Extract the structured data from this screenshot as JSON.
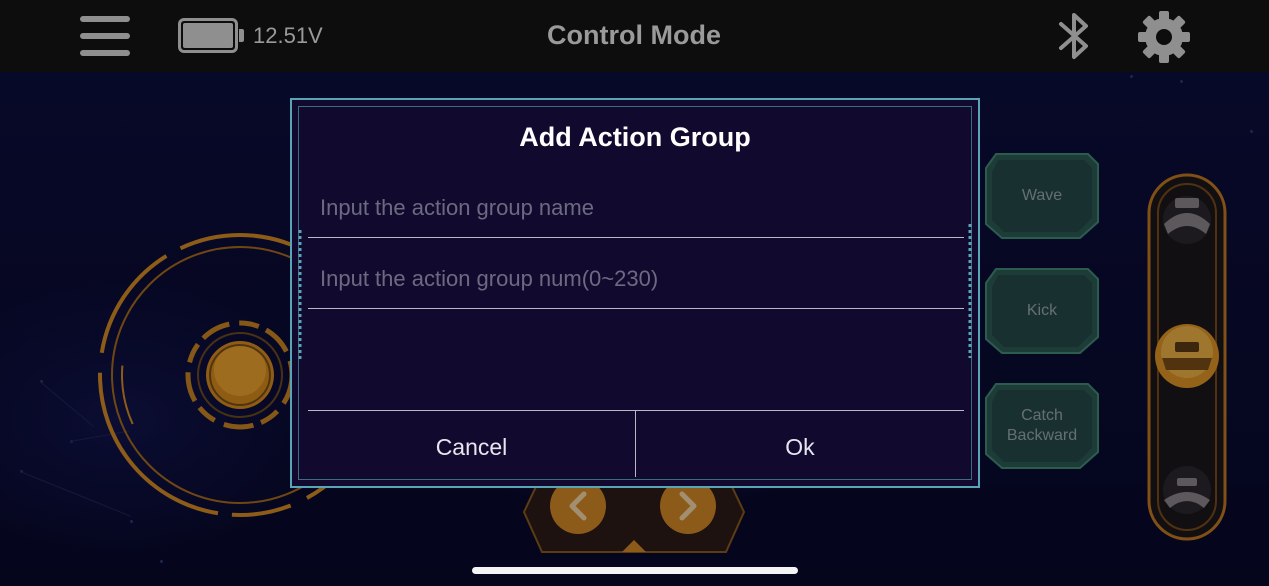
{
  "header": {
    "title": "Control Mode",
    "battery_voltage": "12.51V",
    "menu_icon": "hamburger-menu-icon",
    "battery_icon": "battery-icon",
    "bluetooth_icon": "bluetooth-icon",
    "settings_icon": "gear-icon"
  },
  "actions": [
    {
      "label": "Wave"
    },
    {
      "label": "Kick"
    },
    {
      "label": "Catch\nBackward"
    }
  ],
  "dialog": {
    "title": "Add Action Group",
    "name_placeholder": "Input the action group name",
    "num_placeholder": "Input the action group num(0~230)",
    "cancel_label": "Cancel",
    "ok_label": "Ok"
  },
  "colors": {
    "accent_orange": "#f0a020",
    "dialog_border": "#5aa4b8",
    "dialog_bg": "#120a2e",
    "action_green": "#2f6a52"
  }
}
